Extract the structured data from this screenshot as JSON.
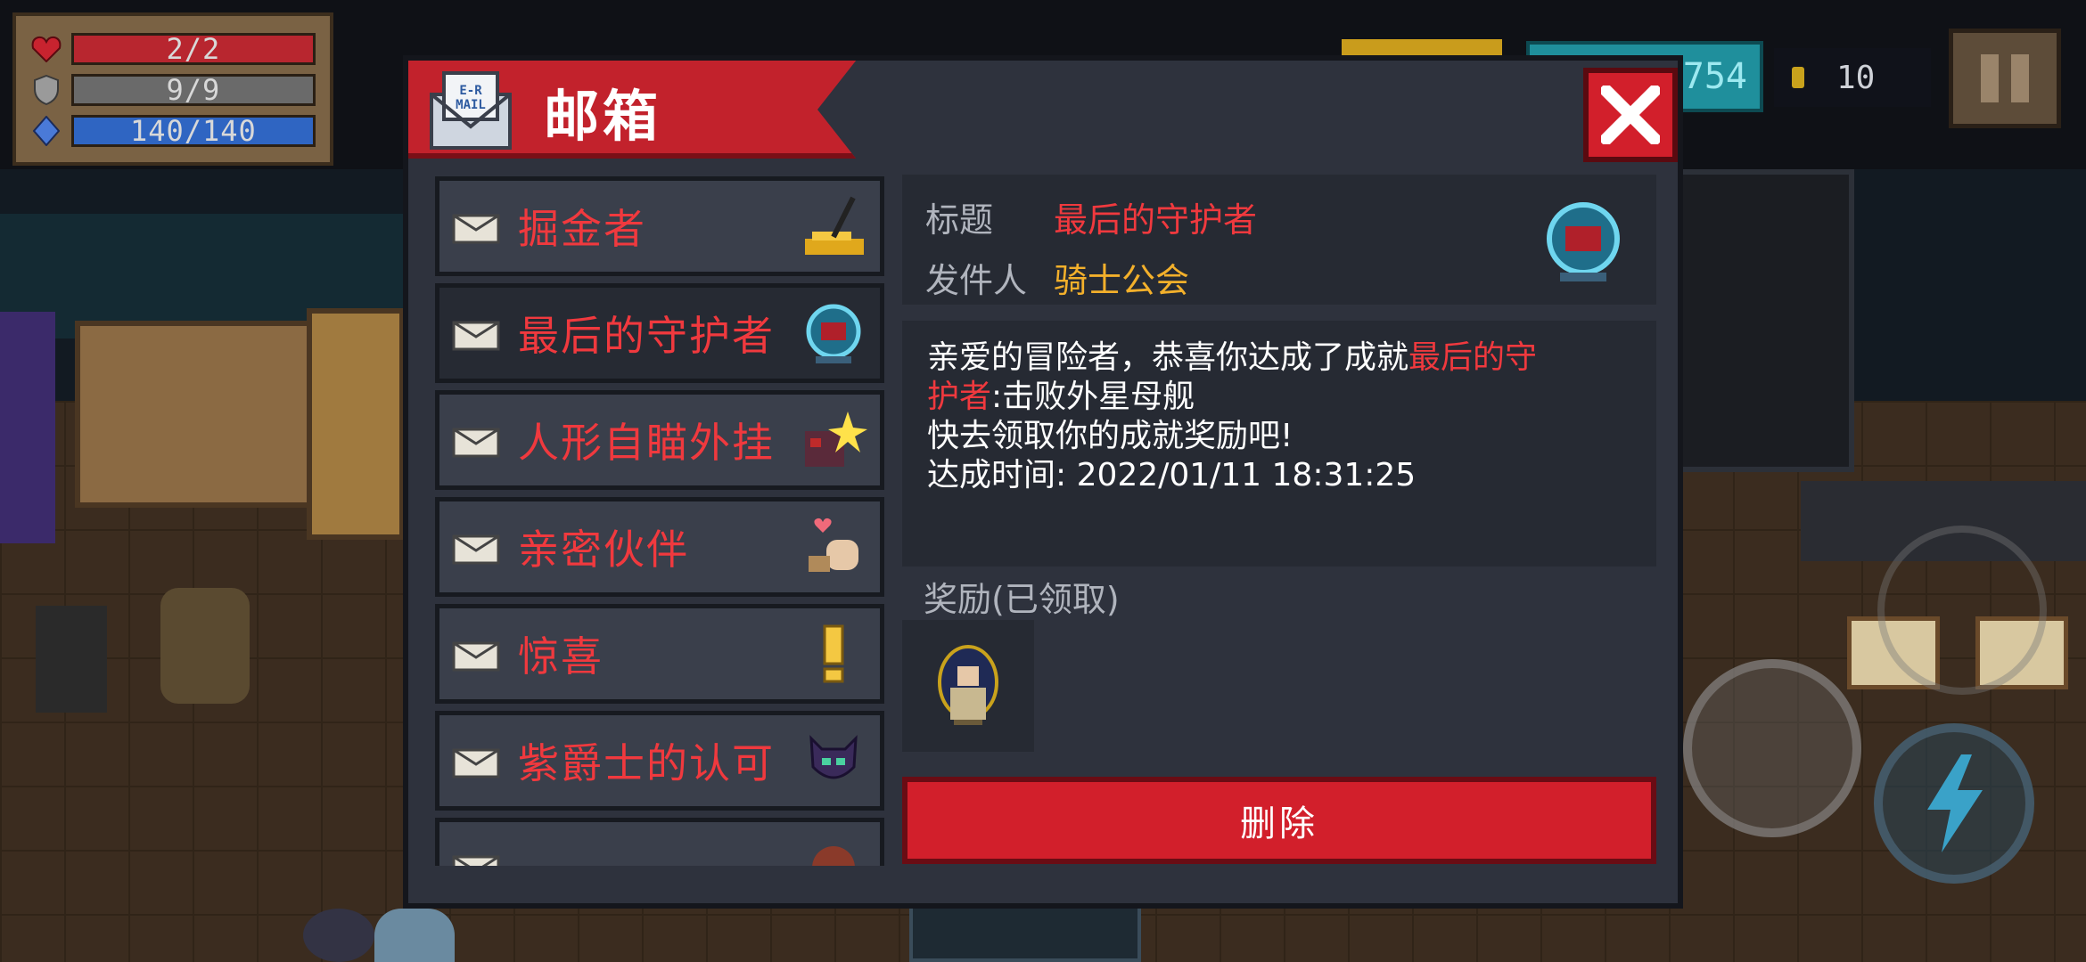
{
  "hud": {
    "health": "2/2",
    "armor": "9/9",
    "energy": "140/140",
    "gems_partial": "754",
    "coins": "10",
    "health_icon": "heart-icon",
    "armor_icon": "shield-icon",
    "energy_icon": "diamond-icon"
  },
  "mailbox": {
    "title": "邮箱",
    "list": [
      {
        "name": "掘金者",
        "badge": "gold-pile-shovel-icon"
      },
      {
        "name": "最后的守护者",
        "badge": "guardian-orb-icon"
      },
      {
        "name": "人形自瞄外挂",
        "badge": "robot-spark-icon"
      },
      {
        "name": "亲密伙伴",
        "badge": "heart-pet-icon"
      },
      {
        "name": "惊喜",
        "badge": "exclamation-icon"
      },
      {
        "name": "紫爵士的认可",
        "badge": "purple-knight-icon"
      },
      {
        "name": "",
        "badge": "partial-icon"
      }
    ],
    "detail": {
      "title_label": "标题",
      "title_value": "最后的守护者",
      "sender_label": "发件人",
      "sender_value": "骑士公会",
      "body_line1_prefix": "亲爱的冒险者，恭喜你达成了成就",
      "body_line1_highlight": "最后的守",
      "body_line2_highlight": "护者",
      "body_line2_suffix": ":击败外星母舰",
      "body_line3": "快去领取你的成就奖励吧!",
      "body_line4": "达成时间: 2022/01/11 18:31:25",
      "reward_label": "奖励(已领取)",
      "delete_label": "删除"
    }
  },
  "colors": {
    "accent_red": "#d21f2b",
    "highlight_red": "#f0393e",
    "sender_gold": "#f3b02b",
    "panel": "#2e323d"
  }
}
